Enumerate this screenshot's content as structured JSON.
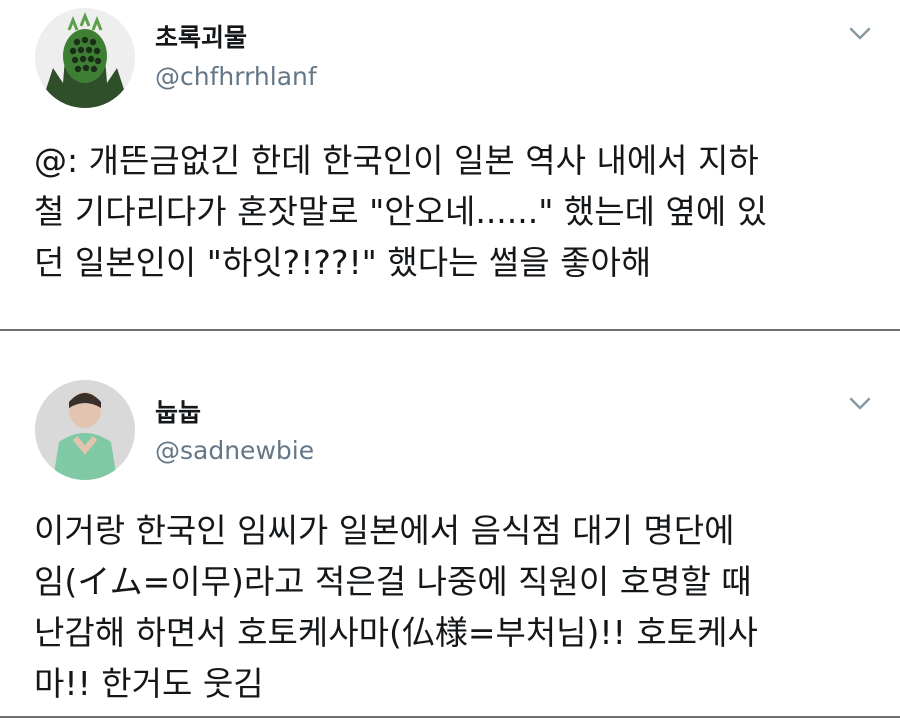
{
  "tweets": [
    {
      "name": "초록괴물",
      "handle": "@chfhrrhlanf",
      "avatar_icon": "green-monster-avatar",
      "menu_icon": "chevron-down-icon",
      "lines": [
        "@: 개뜬금없긴 한데 한국인이 일본 역사 내에서 지하",
        "철 기다리다가 혼잣말로 \"안오네......\" 했는데 옆에 있",
        "던 일본인이 \"하잇?!??!\" 했다는 썰을 좋아해"
      ]
    },
    {
      "name": "눕눕",
      "handle": "@sadnewbie",
      "avatar_icon": "person-green-shirt-avatar",
      "menu_icon": "chevron-down-icon",
      "lines": [
        "이거랑 한국인 임씨가 일본에서 음식점 대기 명단에",
        "임(イム=이무)라고 적은걸 나중에 직원이 호명할 때",
        "난감해 하면서 호토케사마(仏様=부처님)!! 호토케사",
        "마!! 한거도 웃김"
      ]
    }
  ],
  "colors": {
    "text": "#14171a",
    "handle": "#657786",
    "divider": "#6f6f6f",
    "chevron": "#8899a6"
  }
}
